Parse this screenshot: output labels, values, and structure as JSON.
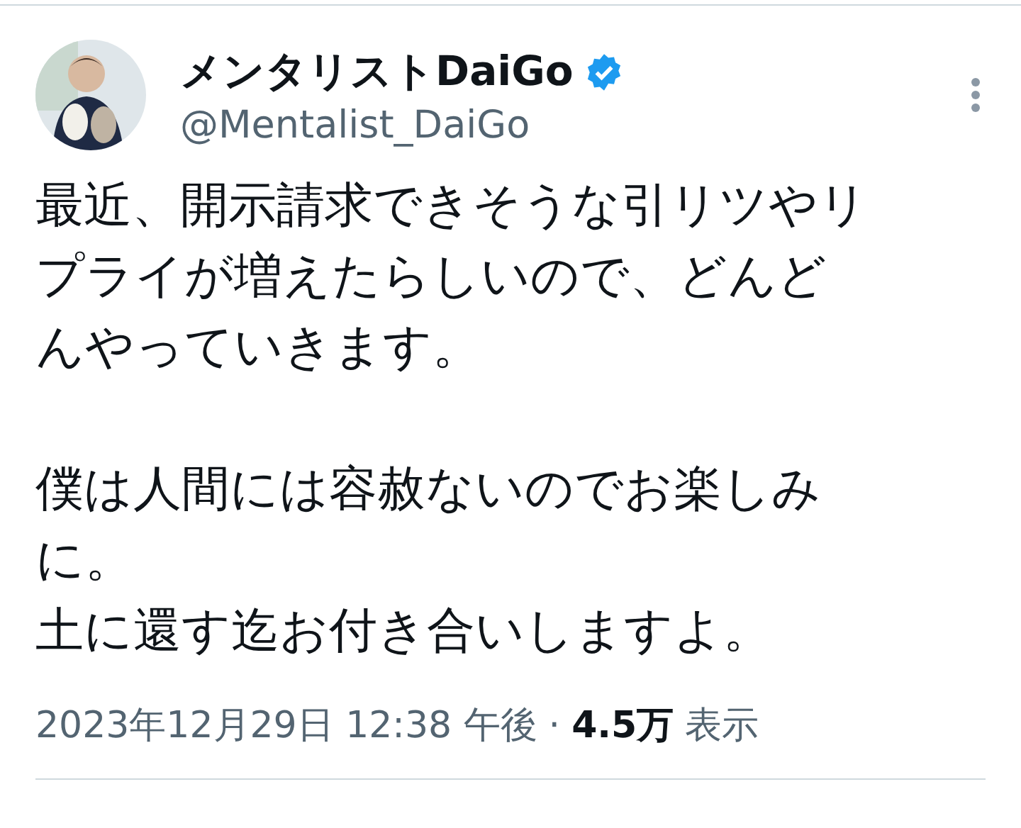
{
  "author": {
    "name": "メンタリストDaiGo",
    "verified": true,
    "handle": "@Mentalist_DaiGo"
  },
  "body": [
    [
      "最近、開示請求できそうな引リツやリプライが増えたらしいので、どんどんやっていきます。"
    ],
    [
      "僕は人間には容赦ないのでお楽しみに。",
      "土に還す迄お付き合いしますよ。"
    ]
  ],
  "meta": {
    "timestamp": "2023年12月29日 12:38 午後",
    "separator": "·",
    "views_count": "4.5万",
    "views_label": "表示"
  }
}
